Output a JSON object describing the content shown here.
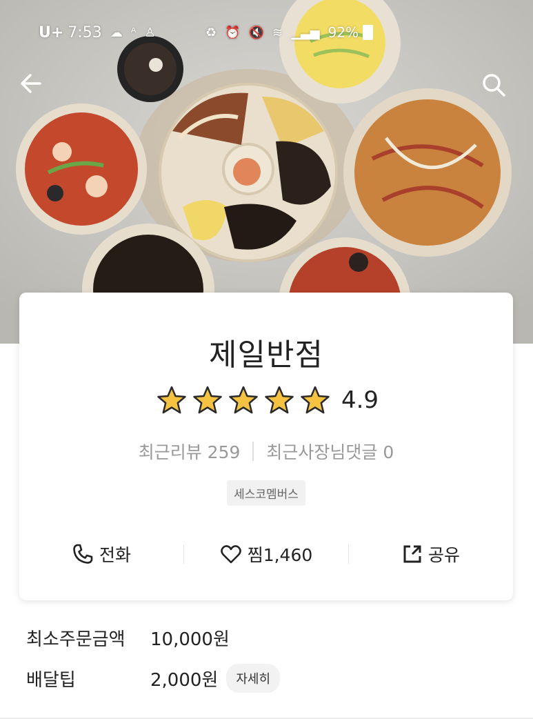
{
  "status_bar": {
    "carrier": "U+",
    "time": "7:53",
    "battery": "92%",
    "icons": [
      "cloud-icon",
      "font-icon",
      "person-icon",
      "recycle-icon",
      "alarm-icon",
      "mute-icon",
      "wifi-icon",
      "signal-icon",
      "battery-icon"
    ]
  },
  "nav": {
    "back_icon": "back-arrow-icon",
    "search_icon": "search-icon"
  },
  "store": {
    "name": "제일반점",
    "rating": "4.9",
    "rating_value": 4.9,
    "stars": 5,
    "review_label": "최근리뷰 259",
    "owner_reply_label": "최근사장님댓글 0",
    "badge": "세스코멤버스"
  },
  "actions": {
    "call_label": "전화",
    "like_label": "찜1,460",
    "share_label": "공유"
  },
  "info": {
    "min_order_label": "최소주문금액",
    "min_order_value": "10,000원",
    "delivery_tip_label": "배달팁",
    "delivery_tip_value": "2,000원",
    "detail_button": "자세히"
  },
  "colors": {
    "star": "#f5c242",
    "star_outline": "#2a2a2a",
    "text": "#222222",
    "muted": "#999999"
  }
}
